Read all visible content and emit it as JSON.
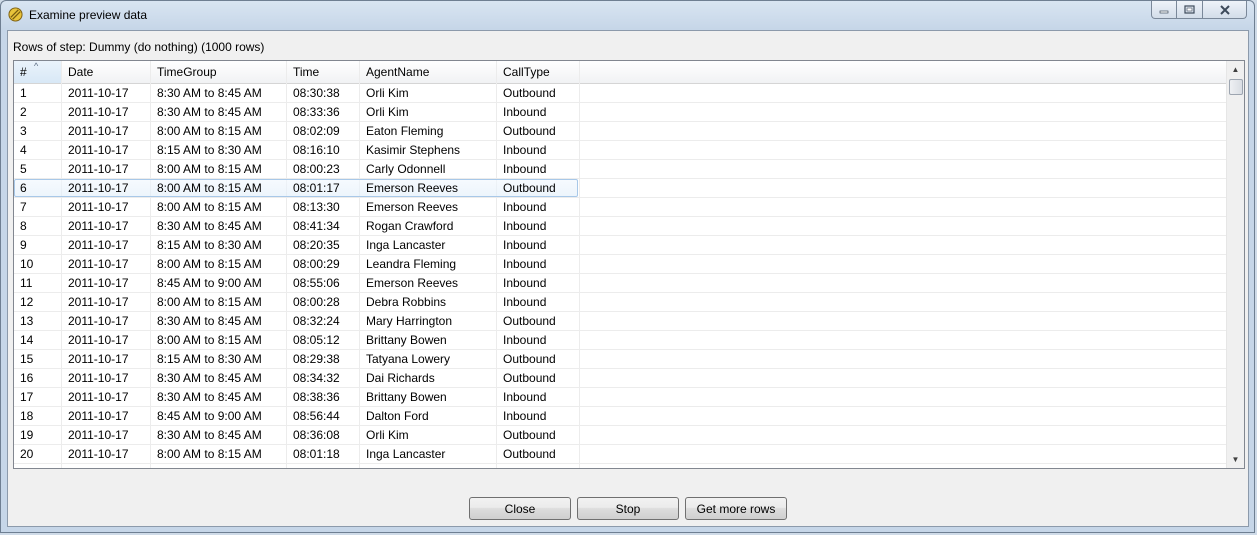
{
  "window": {
    "title": "Examine preview data",
    "icon": "examine-preview-icon"
  },
  "caption_buttons": {
    "minimize": "minimize-icon",
    "maximize": "maximize-icon",
    "close": "close-icon"
  },
  "rows_label": "Rows of step: Dummy (do nothing) (1000 rows)",
  "grid": {
    "columns": [
      "#",
      "Date",
      "TimeGroup",
      "Time",
      "AgentName",
      "CallType"
    ],
    "sorted_column": "#",
    "rows": [
      [
        "1",
        "2011-10-17",
        "8:30 AM to 8:45 AM",
        "08:30:38",
        "Orli Kim",
        "Outbound"
      ],
      [
        "2",
        "2011-10-17",
        "8:30 AM to 8:45 AM",
        "08:33:36",
        "Orli Kim",
        "Inbound"
      ],
      [
        "3",
        "2011-10-17",
        "8:00 AM to 8:15 AM",
        "08:02:09",
        "Eaton Fleming",
        "Outbound"
      ],
      [
        "4",
        "2011-10-17",
        "8:15 AM to 8:30 AM",
        "08:16:10",
        "Kasimir Stephens",
        "Inbound"
      ],
      [
        "5",
        "2011-10-17",
        "8:00 AM to 8:15 AM",
        "08:00:23",
        "Carly Odonnell",
        "Inbound"
      ],
      [
        "6",
        "2011-10-17",
        "8:00 AM to 8:15 AM",
        "08:01:17",
        "Emerson Reeves",
        "Outbound"
      ],
      [
        "7",
        "2011-10-17",
        "8:00 AM to 8:15 AM",
        "08:13:30",
        "Emerson Reeves",
        "Inbound"
      ],
      [
        "8",
        "2011-10-17",
        "8:30 AM to 8:45 AM",
        "08:41:34",
        "Rogan Crawford",
        "Inbound"
      ],
      [
        "9",
        "2011-10-17",
        "8:15 AM to 8:30 AM",
        "08:20:35",
        "Inga Lancaster",
        "Inbound"
      ],
      [
        "10",
        "2011-10-17",
        "8:00 AM to 8:15 AM",
        "08:00:29",
        "Leandra Fleming",
        "Inbound"
      ],
      [
        "11",
        "2011-10-17",
        "8:45 AM to 9:00 AM",
        "08:55:06",
        "Emerson Reeves",
        "Inbound"
      ],
      [
        "12",
        "2011-10-17",
        "8:00 AM to 8:15 AM",
        "08:00:28",
        "Debra Robbins",
        "Inbound"
      ],
      [
        "13",
        "2011-10-17",
        "8:30 AM to 8:45 AM",
        "08:32:24",
        "Mary Harrington",
        "Outbound"
      ],
      [
        "14",
        "2011-10-17",
        "8:00 AM to 8:15 AM",
        "08:05:12",
        "Brittany Bowen",
        "Inbound"
      ],
      [
        "15",
        "2011-10-17",
        "8:15 AM to 8:30 AM",
        "08:29:38",
        "Tatyana Lowery",
        "Outbound"
      ],
      [
        "16",
        "2011-10-17",
        "8:30 AM to 8:45 AM",
        "08:34:32",
        "Dai Richards",
        "Outbound"
      ],
      [
        "17",
        "2011-10-17",
        "8:30 AM to 8:45 AM",
        "08:38:36",
        "Brittany Bowen",
        "Inbound"
      ],
      [
        "18",
        "2011-10-17",
        "8:45 AM to 9:00 AM",
        "08:56:44",
        "Dalton Ford",
        "Inbound"
      ],
      [
        "19",
        "2011-10-17",
        "8:30 AM to 8:45 AM",
        "08:36:08",
        "Orli Kim",
        "Outbound"
      ],
      [
        "20",
        "2011-10-17",
        "8:00 AM to 8:15 AM",
        "08:01:18",
        "Inga Lancaster",
        "Outbound"
      ]
    ],
    "highlighted_row": 6
  },
  "buttons": {
    "close": "Close",
    "stop": "Stop",
    "get_more_rows": "Get more rows"
  }
}
